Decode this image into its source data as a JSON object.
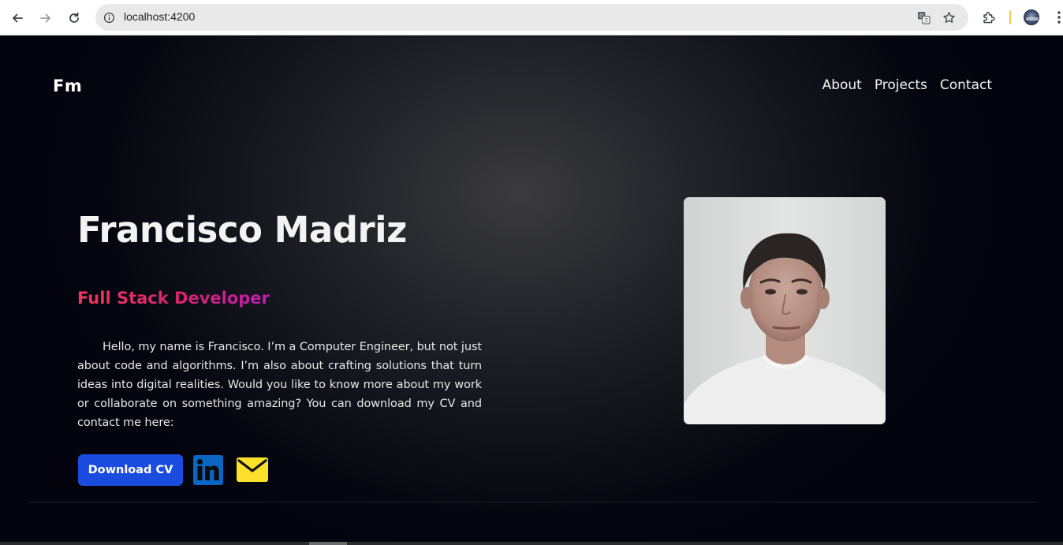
{
  "browser": {
    "url": "localhost:4200",
    "icons": [
      "back-icon",
      "forward-icon",
      "reload-icon",
      "site-info-icon",
      "translate-icon",
      "bookmark-star-icon",
      "extensions-icon",
      "profile-avatar",
      "more-menu-icon"
    ]
  },
  "header": {
    "logo": "Fm",
    "nav": [
      {
        "label": "About"
      },
      {
        "label": "Projects"
      },
      {
        "label": "Contact"
      }
    ]
  },
  "hero": {
    "name": "Francisco Madriz",
    "role": "Full Stack Developer",
    "intro": "Hello, my name is Francisco. I’m a Computer Engineer, but not just about code and algorithms. I’m also about crafting solutions that turn ideas into digital realities. Would you like to know more about my work or collaborate on something amazing? You can download my CV and contact me here:",
    "cv_button": "Download CV",
    "contact_icons": [
      "linkedin-icon",
      "mail-icon"
    ],
    "photo": "profile-photo"
  },
  "colors": {
    "accent_button": "#1a4ce0",
    "role_gradient_start": "#f0365b",
    "role_gradient_end": "#c11bb4",
    "linkedin_blue": "#0a66c2",
    "mail_yellow": "#fde02a"
  }
}
